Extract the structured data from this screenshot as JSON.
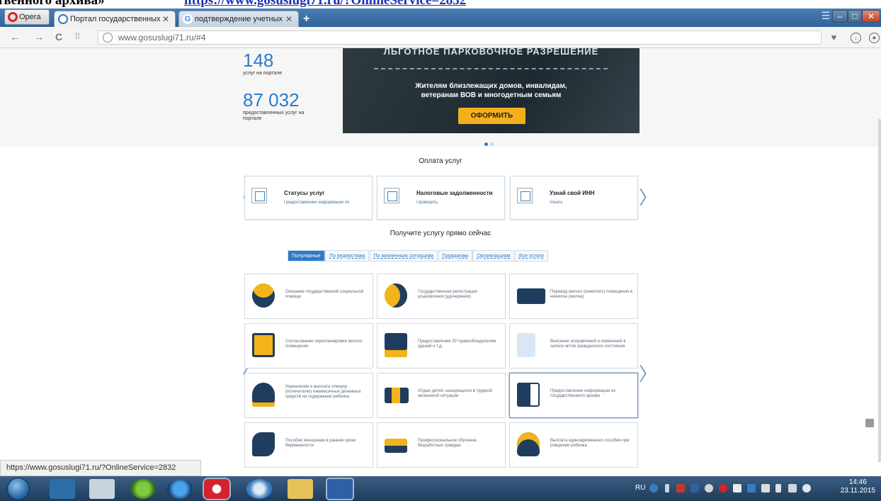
{
  "document_fragment": {
    "text": "твенного архива»",
    "link": "https://www.gosuslugi71.ru/?OnlineService=2832"
  },
  "browser": {
    "menu_label": "Opera",
    "tabs": [
      {
        "title": "Портал государственных",
        "active": true
      },
      {
        "title": "подтверждение учетных",
        "active": false
      }
    ],
    "url": "www.gosuslugi71.ru/#4",
    "status_url": "https://www.gosuslugi71.ru/?OnlineService=2832"
  },
  "stats": [
    {
      "value": "148",
      "caption": "услуг на портале"
    },
    {
      "value": "87 032",
      "caption": "предоставленных услуг на портале"
    }
  ],
  "banner": {
    "heading": "ЛЬГОТНОЕ ПАРКОВОЧНОЕ РАЗРЕШЕНИЕ",
    "text": "Жителям близлежащих домов, инвалидам, ветеранам ВОВ и многодетным семьям",
    "button": "ОФОРМИТЬ",
    "accent": "#f3b01c"
  },
  "payment": {
    "title": "Оплата услуг",
    "cards": [
      {
        "title": "Статусы услуг",
        "subtitle": "Предоставление информации по"
      },
      {
        "title": "Налоговые задолженности",
        "subtitle": "Проверить"
      },
      {
        "title": "Узнай свой ИНН",
        "subtitle": "Узнать"
      }
    ]
  },
  "services": {
    "title": "Получите услугу прямо сейчас",
    "tabs": [
      "Популярные",
      "По ведомствам",
      "По жизненным ситуациям",
      "Гражданам",
      "Организациям",
      "Все услуги"
    ],
    "cards": [
      {
        "label": "Оказание государственной социальной помощи",
        "icon": "hands-heart-icon"
      },
      {
        "label": "Государственная регистрация усыновления (удочерения)",
        "icon": "family-icon"
      },
      {
        "label": "Перевод жилого (нежилого) помещения в нежилое (жилое)",
        "icon": "building-transfer-icon"
      },
      {
        "label": "Согласование перепланировки жилого помещения",
        "icon": "floor-plan-icon"
      },
      {
        "label": "Предоставление ЗУ правообладателям зданий и т.д.",
        "icon": "house-land-icon"
      },
      {
        "label": "Внесение исправлений и изменений в записи актов гражданского состояния",
        "icon": "document-icon"
      },
      {
        "label": "Назначение и выплата опекуну (попечителю) ежемесячных денежных средств на содержание ребенка",
        "icon": "guardian-icon"
      },
      {
        "label": "Отдых детей, находящихся в трудной жизненной ситуации",
        "icon": "children-icon"
      },
      {
        "label": "Предоставление информации из государственного архива",
        "icon": "archive-icon"
      },
      {
        "label": "Пособие женщинам в ранние сроки беременности",
        "icon": "pregnancy-icon"
      },
      {
        "label": "Профессиональное обучение безработных граждан",
        "icon": "books-icon"
      },
      {
        "label": "Выплата единовременного пособия при рождении ребенка",
        "icon": "stroller-icon"
      }
    ]
  },
  "taskbar": {
    "lang": "RU",
    "time": "14:46",
    "date": "23.11.2015"
  }
}
